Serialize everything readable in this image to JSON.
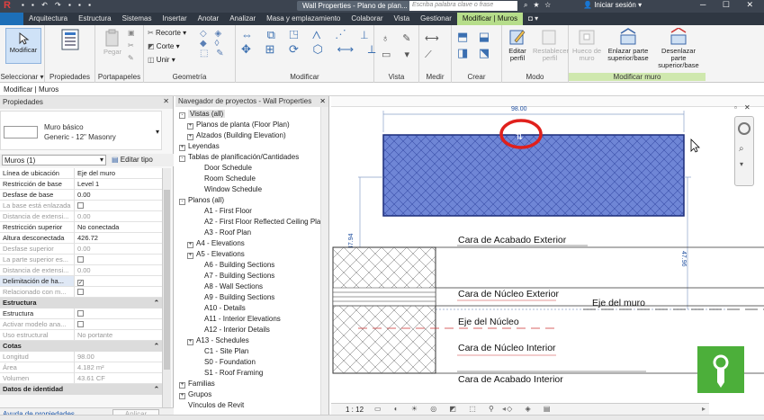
{
  "titlebar": {
    "title": "Wall Properties - Plano de plan...",
    "search_placeholder": "Escriba palabra clave o frase",
    "user": "Iniciar sesión"
  },
  "tabs": [
    "Arquitectura",
    "Estructura",
    "Sistemas",
    "Insertar",
    "Anotar",
    "Analizar",
    "Masa y emplazamiento",
    "Colaborar",
    "Vista",
    "Gestionar",
    "Modificar | Muros"
  ],
  "ribbon": {
    "modificar_label": "Modificar",
    "seleccionar_label": "Seleccionar",
    "propiedades_label": "Propiedades",
    "portapapeles_label": "Portapapeles",
    "pegar_label": "Pegar",
    "geometria_label": "Geometría",
    "recorte_label": "Recorte",
    "corte_label": "Corte",
    "unir_label": "Unir",
    "modificar_panel_label": "Modificar",
    "vista_label": "Vista",
    "medir_label": "Medir",
    "crear_label": "Crear",
    "editar_perfil": "Editar perfil",
    "restablecer_perfil": "Restablecer perfil",
    "modo_label": "Modo",
    "hueco_muro": "Hueco de muro",
    "enlazar_parte": "Enlazar parte superior/base",
    "desenlazar_parte": "Desenlazar parte superior/base",
    "modificar_muro_label": "Modificar muro"
  },
  "context_bar": "Modificar | Muros",
  "properties": {
    "header": "Propiedades",
    "type_name": "Muro básico",
    "type_sub": "Generic - 12\" Masonry",
    "instance_select": "Muros (1)",
    "edit_type": "Editar tipo",
    "rows": [
      {
        "k": "Línea de ubicación",
        "v": "Eje del muro",
        "dim": false
      },
      {
        "k": "Restricción de base",
        "v": "Level 1",
        "dim": false
      },
      {
        "k": "Desfase de base",
        "v": "0.00",
        "dim": false
      },
      {
        "k": "La base está enlazada",
        "v": "",
        "cb": true,
        "dim": true
      },
      {
        "k": "Distancia de extensi...",
        "v": "0.00",
        "dim": true
      },
      {
        "k": "Restricción superior",
        "v": "No conectada",
        "dim": false
      },
      {
        "k": "Altura desconectada",
        "v": "426.72",
        "dim": false
      },
      {
        "k": "Desfase superior",
        "v": "0.00",
        "dim": true
      },
      {
        "k": "La parte superior es...",
        "v": "",
        "cb": true,
        "dim": true
      },
      {
        "k": "Distancia de extensi...",
        "v": "0.00",
        "dim": true
      },
      {
        "k": "Delimitación de ha...",
        "v": "✓",
        "cb": true,
        "dim": false
      },
      {
        "k": "Relacionado con m...",
        "v": "",
        "cb": true,
        "dim": true
      }
    ],
    "section_estructura": "Estructura",
    "rows2": [
      {
        "k": "Estructura",
        "v": "",
        "cb": true,
        "dim": false
      },
      {
        "k": "Activar modelo ana...",
        "v": "",
        "cb": true,
        "dim": true
      },
      {
        "k": "Uso estructural",
        "v": "No portante",
        "dim": true
      }
    ],
    "section_cotas": "Cotas",
    "rows3": [
      {
        "k": "Longitud",
        "v": "98.00",
        "dim": true
      },
      {
        "k": "Área",
        "v": "4.182 m²",
        "dim": true
      },
      {
        "k": "Volumen",
        "v": "43.61 CF",
        "dim": true
      }
    ],
    "section_identidad": "Datos de identidad",
    "help": "Ayuda de propiedades",
    "apply": "Aplicar"
  },
  "browser": {
    "header": "Navegador de proyectos - Wall Properties",
    "nodes": [
      {
        "t": "Vistas (all)",
        "lvl": 0,
        "exp": "-"
      },
      {
        "t": "Planos de planta (Floor Plan)",
        "lvl": 1,
        "exp": "+"
      },
      {
        "t": "Alzados (Building Elevation)",
        "lvl": 1,
        "exp": "+"
      },
      {
        "t": "Leyendas",
        "lvl": 0,
        "exp": "+"
      },
      {
        "t": "Tablas de planificación/Cantidades",
        "lvl": 0,
        "exp": "-"
      },
      {
        "t": "Door Schedule",
        "lvl": 2,
        "exp": ""
      },
      {
        "t": "Room Schedule",
        "lvl": 2,
        "exp": ""
      },
      {
        "t": "Window Schedule",
        "lvl": 2,
        "exp": ""
      },
      {
        "t": "Planos (all)",
        "lvl": 0,
        "exp": "-"
      },
      {
        "t": "A1 - First Floor",
        "lvl": 2,
        "exp": ""
      },
      {
        "t": "A2 - First Floor Reflected Ceiling Plan",
        "lvl": 2,
        "exp": ""
      },
      {
        "t": "A3 - Roof Plan",
        "lvl": 2,
        "exp": ""
      },
      {
        "t": "A4 - Elevations",
        "lvl": 1,
        "exp": "+"
      },
      {
        "t": "A5 - Elevations",
        "lvl": 1,
        "exp": "+"
      },
      {
        "t": "A6 - Building Sections",
        "lvl": 2,
        "exp": ""
      },
      {
        "t": "A7 - Building Sections",
        "lvl": 2,
        "exp": ""
      },
      {
        "t": "A8 - Wall Sections",
        "lvl": 2,
        "exp": ""
      },
      {
        "t": "A9 - Building Sections",
        "lvl": 2,
        "exp": ""
      },
      {
        "t": "A10 - Details",
        "lvl": 2,
        "exp": ""
      },
      {
        "t": "A11 - Interior Elevations",
        "lvl": 2,
        "exp": ""
      },
      {
        "t": "A12 - Interior Details",
        "lvl": 2,
        "exp": ""
      },
      {
        "t": "A13 - Schedules",
        "lvl": 1,
        "exp": "+"
      },
      {
        "t": "C1 - Site Plan",
        "lvl": 2,
        "exp": ""
      },
      {
        "t": "S0 - Foundation",
        "lvl": 2,
        "exp": ""
      },
      {
        "t": "S1 - Roof Framing",
        "lvl": 2,
        "exp": ""
      },
      {
        "t": "Familias",
        "lvl": 0,
        "exp": "+"
      },
      {
        "t": "Grupos",
        "lvl": 0,
        "exp": "+"
      },
      {
        "t": "Vínculos de Revit",
        "lvl": 0,
        "exp": ""
      }
    ]
  },
  "canvas": {
    "dim_top": "98.00",
    "dim_left": "47.94",
    "dim_right": "47.96",
    "label_ext": "Cara de Acabado Exterior",
    "label_core_ext": "Cara de Núcleo Exterior",
    "label_eje_muro": "Eje del muro",
    "label_eje_nucleo": "Eje del Núcleo",
    "label_core_int": "Cara de Núcleo Interior",
    "label_int": "Cara de Acabado Interior",
    "scale": "1 : 12",
    "wall_fill": "#6f86d6",
    "highlight": "#e0201c",
    "badge": "#4caf3a"
  }
}
